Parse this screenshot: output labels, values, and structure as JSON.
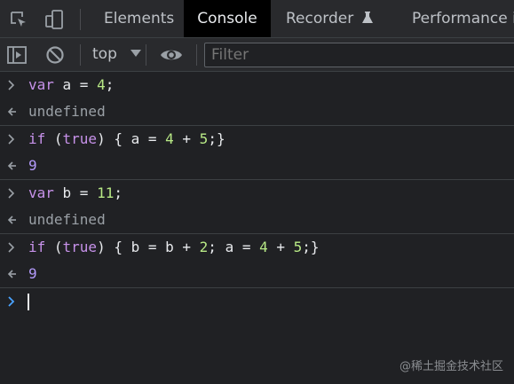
{
  "tabs": [
    {
      "label": "Elements"
    },
    {
      "label": "Console"
    },
    {
      "label": "Recorder"
    },
    {
      "label": "Performance in"
    }
  ],
  "toolbar": {
    "context": "top",
    "filter_placeholder": "Filter"
  },
  "console": {
    "entries": [
      {
        "type": "input",
        "tokens": [
          [
            "kw",
            "var"
          ],
          [
            "txtc",
            " a = "
          ],
          [
            "num",
            "4"
          ],
          [
            "txtc",
            ";"
          ]
        ]
      },
      {
        "type": "result",
        "value": "undefined"
      },
      {
        "type": "input",
        "tokens": [
          [
            "kw",
            "if"
          ],
          [
            "txtc",
            " ("
          ],
          [
            "kw",
            "true"
          ],
          [
            "txtc",
            ") { a = "
          ],
          [
            "num",
            "4"
          ],
          [
            "txtc",
            " + "
          ],
          [
            "num",
            "5"
          ],
          [
            "txtc",
            ";}"
          ]
        ]
      },
      {
        "type": "result",
        "value": "9"
      },
      {
        "type": "input",
        "tokens": [
          [
            "kw",
            "var"
          ],
          [
            "txtc",
            " b = "
          ],
          [
            "num",
            "11"
          ],
          [
            "txtc",
            ";"
          ]
        ]
      },
      {
        "type": "result",
        "value": "undefined"
      },
      {
        "type": "input",
        "tokens": [
          [
            "kw",
            "if"
          ],
          [
            "txtc",
            " ("
          ],
          [
            "kw",
            "true"
          ],
          [
            "txtc",
            ") { b = b + "
          ],
          [
            "num",
            "2"
          ],
          [
            "txtc",
            "; a = "
          ],
          [
            "num",
            "4"
          ],
          [
            "txtc",
            " + "
          ],
          [
            "num",
            "5"
          ],
          [
            "txtc",
            ";}"
          ]
        ]
      },
      {
        "type": "result",
        "value": "9"
      }
    ]
  },
  "watermark": "@稀土掘金技术社区"
}
